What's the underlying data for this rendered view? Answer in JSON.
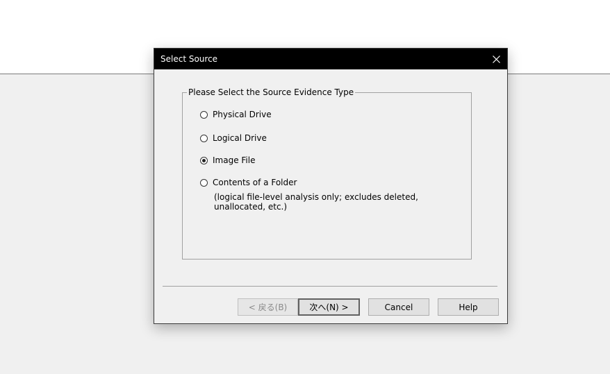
{
  "dialog": {
    "title": "Select Source",
    "close_icon": "close-icon",
    "group_label": "Please Select the Source Evidence Type",
    "options": [
      {
        "label": "Physical Drive",
        "selected": false
      },
      {
        "label": "Logical Drive",
        "selected": false
      },
      {
        "label": "Image File",
        "selected": true
      },
      {
        "label": "Contents of a Folder",
        "selected": false
      }
    ],
    "folder_note": "(logical file-level analysis only; excludes deleted, unallocated, etc.)",
    "buttons": {
      "back": "< 戻る(B)",
      "next": "次へ(N) >",
      "cancel": "Cancel",
      "help": "Help"
    }
  },
  "colors": {
    "titlebar_bg": "#000000",
    "dialog_bg": "#f0f0f0",
    "button_bg": "#e1e1e1"
  }
}
